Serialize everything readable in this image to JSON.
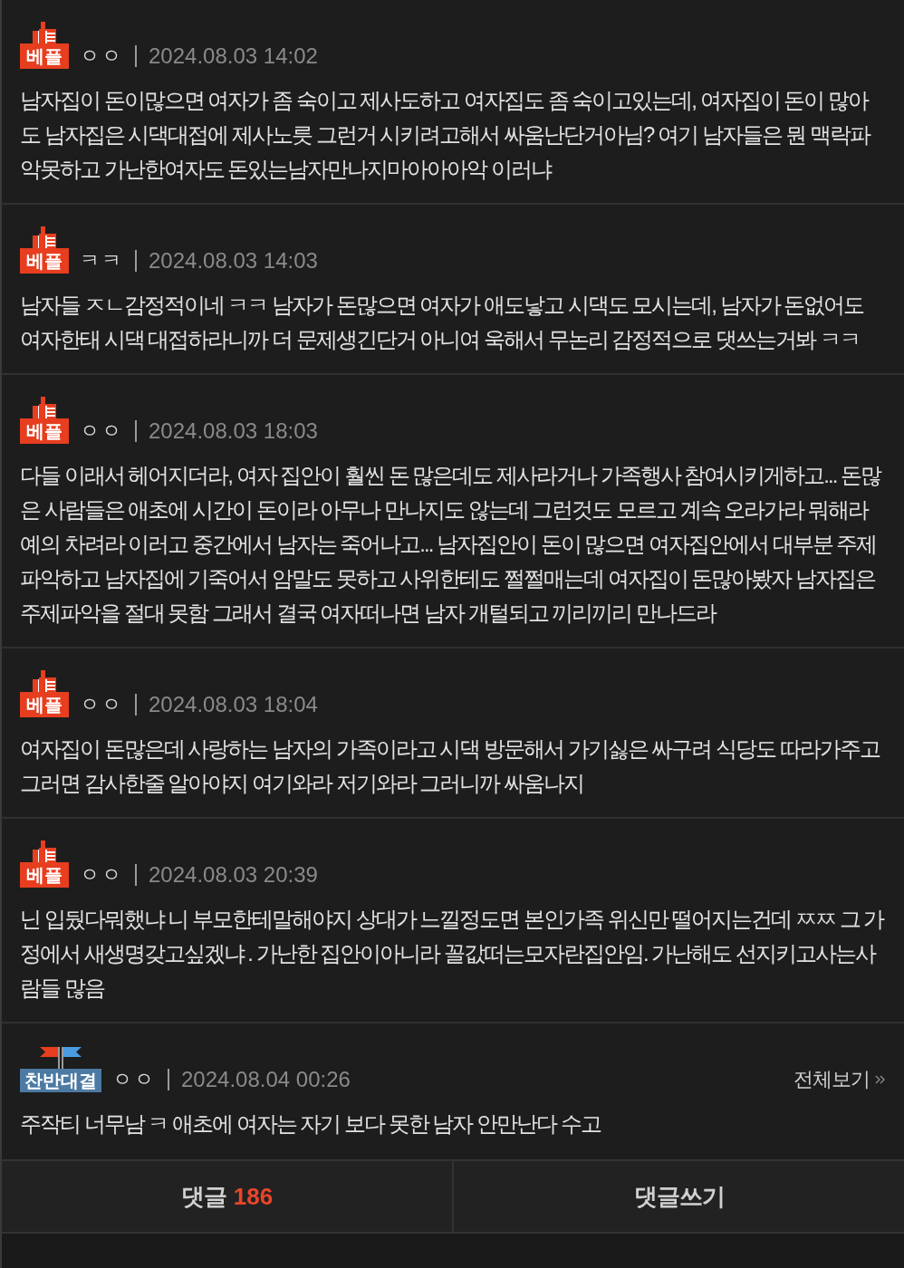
{
  "comments": [
    {
      "badge": {
        "kind": "best",
        "label": "베플"
      },
      "nickname": "ㅇㅇ",
      "date": "2024.08.03 14:02",
      "body": "남자집이 돈이많으면 여자가 좀 숙이고 제사도하고 여자집도 좀 숙이고있는데, 여자집이 돈이 많아도 남자집은 시댁대접에 제사노릇 그런거 시키려고해서 싸움난단거아님? 여기 남자들은 뭔 맥락파악못하고 가난한여자도 돈있는남자만나지마아아아악 이러냐"
    },
    {
      "badge": {
        "kind": "best",
        "label": "베플"
      },
      "nickname": "ㅋㅋ",
      "date": "2024.08.03 14:03",
      "body": "남자들 ㅈㄴ감정적이네 ㅋㅋ 남자가 돈많으면 여자가 애도낳고 시댁도 모시는데, 남자가 돈없어도 여자한태 시댁 대접하라니까 더 문제생긴단거 아니여 욱해서 무논리 감정적으로 댓쓰는거봐 ㅋㅋ"
    },
    {
      "badge": {
        "kind": "best",
        "label": "베플"
      },
      "nickname": "ㅇㅇ",
      "date": "2024.08.03 18:03",
      "body": "다들 이래서 헤어지더라, 여자 집안이 훨씬 돈 많은데도 제사라거나 가족행사 참여시키게하고... 돈많은 사람들은 애초에 시간이 돈이라 아무나 만나지도 않는데 그런것도 모르고 계속 오라가라 뭐해라 예의 차려라 이러고 중간에서 남자는 죽어나고... 남자집안이 돈이 많으면 여자집안에서 대부분 주제파악하고 남자집에 기죽어서 암말도 못하고 사위한테도 쩔쩔매는데 여자집이 돈많아봤자 남자집은 주제파악을 절대 못함 그래서 결국 여자떠나면 남자 개털되고 끼리끼리 만나드라"
    },
    {
      "badge": {
        "kind": "best",
        "label": "베플"
      },
      "nickname": "ㅇㅇ",
      "date": "2024.08.03 18:04",
      "body": "여자집이 돈많은데 사랑하는 남자의 가족이라고 시댁 방문해서 가기싫은 싸구려 식당도 따라가주고 그러면 감사한줄 알아야지 여기와라 저기와라 그러니까 싸움나지"
    },
    {
      "badge": {
        "kind": "best",
        "label": "베플"
      },
      "nickname": "ㅇㅇ",
      "date": "2024.08.03 20:39",
      "body": "닌 입뒀다뭐했냐 니 부모한테말해야지 상대가 느낄정도면 본인가족 위신만 떨어지는건데 ㅉㅉ 그 가정에서 새생명갖고싶겠냐 . 가난한 집안이아니라 꼴값떠는모자란집안임. 가난해도 선지키고사는사람들 많음"
    },
    {
      "badge": {
        "kind": "versus",
        "label": "찬반대결"
      },
      "nickname": "ㅇㅇ",
      "date": "2024.08.04 00:26",
      "view_all": "전체보기",
      "body": "주작티 너무남 ㅋ 애초에 여자는 자기 보다 못한 남자 안만난다 수고"
    }
  ],
  "footer": {
    "comment_label": "댓글",
    "comment_count": "186",
    "write_button": "댓글쓰기"
  }
}
